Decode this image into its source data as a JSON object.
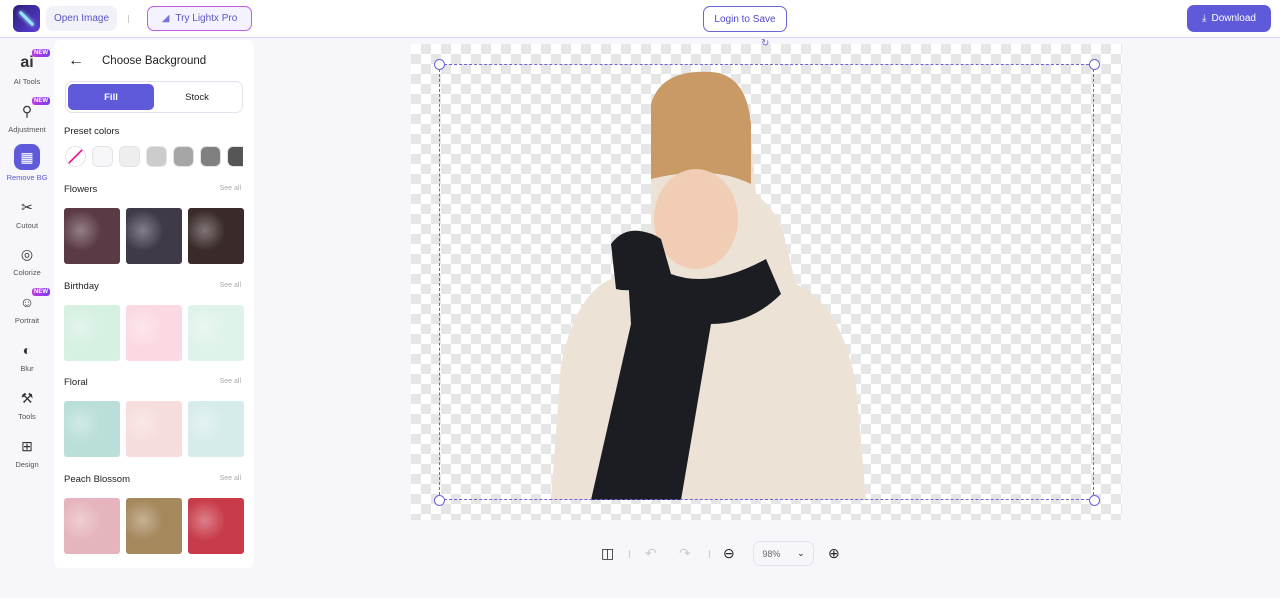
{
  "topbar": {
    "open_image": "Open Image",
    "try_pro": "Try Lightx Pro",
    "login": "Login to Save",
    "download": "Download"
  },
  "rail": [
    {
      "label": "AI Tools",
      "icon": "ai-icon",
      "new": "NEW"
    },
    {
      "label": "Adjustment",
      "icon": "sliders-icon",
      "new": "NEW"
    },
    {
      "label": "Remove BG",
      "icon": "remove-bg-icon"
    },
    {
      "label": "Cutout",
      "icon": "scissors-icon"
    },
    {
      "label": "Colorize",
      "icon": "drop-icon"
    },
    {
      "label": "Portrait",
      "icon": "portrait-icon",
      "new": "NEW"
    },
    {
      "label": "Blur",
      "icon": "blur-icon"
    },
    {
      "label": "Tools",
      "icon": "tools-icon"
    },
    {
      "label": "Design",
      "icon": "design-icon"
    }
  ],
  "panel": {
    "title": "Choose Background",
    "tabs": [
      "Fill",
      "Stock"
    ],
    "preset_label": "Preset colors",
    "preset_colors": [
      "none",
      "#f7f7f9",
      "#eeeeee",
      "#cccccc",
      "#a6a6a6",
      "#808080",
      "#555555"
    ],
    "see_all": "See all",
    "sections": [
      {
        "title": "Flowers",
        "colors": [
          "#5a3a44",
          "#3e3a48",
          "#3a2a2a"
        ]
      },
      {
        "title": "Birthday",
        "colors": [
          "#d6f0e2",
          "#fbd9e2",
          "#dff3ea"
        ]
      },
      {
        "title": "Floral",
        "colors": [
          "#b9dfd8",
          "#f6dcdc",
          "#d6ecea"
        ]
      },
      {
        "title": "Peach Blossom",
        "colors": [
          "#e6b4bc",
          "#a5885c",
          "#c83c4a"
        ]
      }
    ]
  },
  "toolbar": {
    "zoom": "98%"
  }
}
